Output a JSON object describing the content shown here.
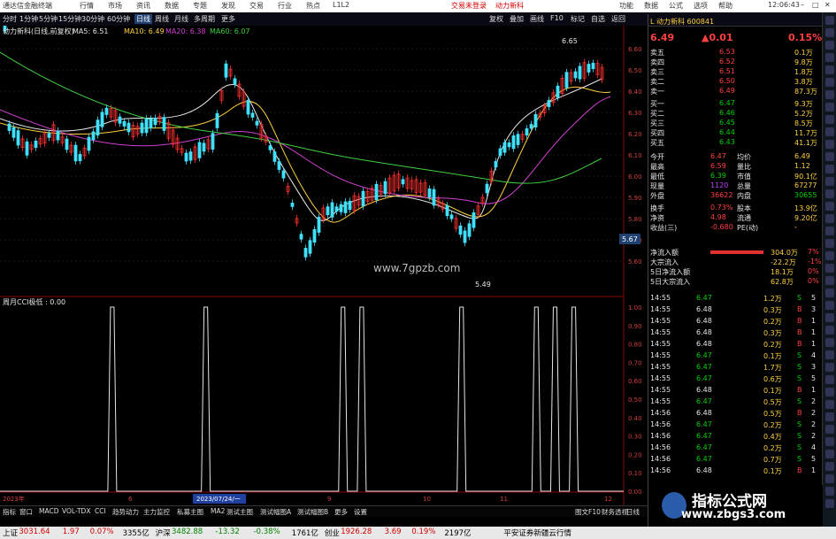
{
  "app": {
    "title": "通达信金融终端",
    "menu": [
      "行情",
      "市场",
      "资讯",
      "数据",
      "专题",
      "发现",
      "交易",
      "行业",
      "热点",
      "L1L2"
    ],
    "center_links": [
      "交易未登录",
      "动力新科"
    ],
    "right_menu": [
      "功能",
      "数据",
      "公式",
      "选项",
      "帮助"
    ]
  },
  "toolbar": {
    "periods": [
      "分时",
      "1分钟",
      "5分钟",
      "15分钟",
      "30分钟",
      "60分钟",
      "日线",
      "周线",
      "月线",
      "多周期",
      "更多"
    ],
    "active_period": "日线",
    "right_buttons": [
      "复权",
      "叠加",
      "画线",
      "F10",
      "标记",
      "自选",
      "返回"
    ]
  },
  "chart": {
    "stock_title": "动力新科(日线,前复权)",
    "ma_legend": [
      {
        "label": "MA5: 6.51",
        "color": "#e6e6e6"
      },
      {
        "label": "MA10: 6.49",
        "color": "#ffd040"
      },
      {
        "label": "MA20: 6.38",
        "color": "#d040d0"
      },
      {
        "label": "MA60: 6.07",
        "color": "#40d040"
      }
    ],
    "price_axis": [
      "6.60",
      "6.50",
      "6.40",
      "6.30",
      "6.20",
      "6.10",
      "6.00",
      "5.90",
      "5.80",
      "5.70",
      "5.60"
    ],
    "current_price_tag": "5.67",
    "high_annot": "6.65",
    "low_annot": "5.49",
    "site_text": "www.7gpzb.com",
    "indicator_title": "周月CCI极低 : 0.00",
    "indicator_axis": [
      "1.00",
      "0.90",
      "0.80",
      "0.70",
      "0.60",
      "0.50",
      "0.40",
      "0.30",
      "0.20",
      "0.10",
      "0.00"
    ],
    "date_labels": [
      "2023年",
      "6",
      "7",
      "2023/07/24/一",
      "9",
      "10",
      "11",
      "12"
    ],
    "spike_positions": [
      0.18,
      0.33,
      0.55,
      0.58,
      0.74,
      0.86,
      0.89,
      0.92
    ]
  },
  "bottom_tabs": [
    "指标",
    "窗口",
    "MACD",
    "VOL-TDX",
    "CCI",
    "趋势动力",
    "主力监控",
    "私募主图",
    "MA2",
    "测试主图",
    "测试幅图A",
    "测试幅图B",
    "更多",
    "设置"
  ],
  "bottom_tabs_right": [
    "图文F10",
    "财务透视",
    "日线"
  ],
  "quote": {
    "code_label": "L 动力新科 600841",
    "price": "6.49",
    "change": "▲0.01",
    "pct": "0.15%",
    "asks": [
      {
        "label": "卖五",
        "price": "6.53",
        "vol": "0.1万"
      },
      {
        "label": "卖四",
        "price": "6.52",
        "vol": "9.8万"
      },
      {
        "label": "卖三",
        "price": "6.51",
        "vol": "1.8万"
      },
      {
        "label": "卖二",
        "price": "6.50",
        "vol": "3.8万"
      },
      {
        "label": "卖一",
        "price": "6.49",
        "vol": "87.3万"
      }
    ],
    "bids": [
      {
        "label": "买一",
        "price": "6.47",
        "vol": "9.3万"
      },
      {
        "label": "买二",
        "price": "6.46",
        "vol": "5.2万"
      },
      {
        "label": "买三",
        "price": "6.45",
        "vol": "8.5万"
      },
      {
        "label": "买四",
        "price": "6.44",
        "vol": "11.7万"
      },
      {
        "label": "买五",
        "price": "6.43",
        "vol": "41.1万"
      }
    ],
    "stats": [
      {
        "l1": "今开",
        "v1": "6.47",
        "l2": "均价",
        "v2": "6.49"
      },
      {
        "l1": "最高",
        "v1": "6.59",
        "l2": "量比",
        "v2": "1.12"
      },
      {
        "l1": "最低",
        "v1": "6.39",
        "l2": "市值",
        "v2": "90.1亿"
      },
      {
        "l1": "现量",
        "v1": "1120",
        "l2": "总量",
        "v2": "67277"
      },
      {
        "l1": "外盘",
        "v1": "36622",
        "l2": "内盘",
        "v2": "30655"
      },
      {
        "l1": "换手",
        "v1": "0.73%",
        "l2": "股本",
        "v2": "13.9亿"
      },
      {
        "l1": "净资",
        "v1": "4.98",
        "l2": "流通",
        "v2": "9.20亿"
      },
      {
        "l1": "收益(三)",
        "v1": "-0.680",
        "l2": "PE(动)",
        "v2": "-"
      }
    ],
    "flows": [
      {
        "label": "净流入额",
        "value": "304.0万",
        "pct": "7%"
      },
      {
        "label": "大宗流入",
        "value": "-22.2万",
        "pct": "-1%"
      },
      {
        "label": "5日净流入额",
        "value": "18.1万",
        "pct": "0%"
      },
      {
        "label": "5日大宗流入",
        "value": "62.8万",
        "pct": "0%"
      }
    ],
    "ticks": [
      {
        "t": "14:55",
        "p": "6.47",
        "v": "1.2万",
        "s": "S",
        "n": "5"
      },
      {
        "t": "14:55",
        "p": "6.48",
        "v": "0.3万",
        "s": "B",
        "n": "3"
      },
      {
        "t": "14:55",
        "p": "6.48",
        "v": "0.2万",
        "s": "B",
        "n": "1"
      },
      {
        "t": "14:55",
        "p": "6.48",
        "v": "0.3万",
        "s": "B",
        "n": "1"
      },
      {
        "t": "14:55",
        "p": "6.48",
        "v": "0.2万",
        "s": "B",
        "n": "1"
      },
      {
        "t": "14:55",
        "p": "6.47",
        "v": "0.1万",
        "s": "S",
        "n": "4"
      },
      {
        "t": "14:55",
        "p": "6.47",
        "v": "1.7万",
        "s": "S",
        "n": "3"
      },
      {
        "t": "14:55",
        "p": "6.47",
        "v": "0.6万",
        "s": "S",
        "n": "5"
      },
      {
        "t": "14:55",
        "p": "6.48",
        "v": "0.1万",
        "s": "B",
        "n": "1"
      },
      {
        "t": "14:55",
        "p": "6.47",
        "v": "0.5万",
        "s": "S",
        "n": "2"
      },
      {
        "t": "14:56",
        "p": "6.48",
        "v": "0.5万",
        "s": "B",
        "n": "2"
      },
      {
        "t": "14:56",
        "p": "6.47",
        "v": "0.2万",
        "s": "S",
        "n": "2"
      },
      {
        "t": "14:56",
        "p": "6.47",
        "v": "0.4万",
        "s": "S",
        "n": "2"
      },
      {
        "t": "14:56",
        "p": "6.47",
        "v": "0.2万",
        "s": "S",
        "n": "4"
      },
      {
        "t": "14:56",
        "p": "6.47",
        "v": "0.7万",
        "s": "S",
        "n": "5"
      },
      {
        "t": "14:56",
        "p": "6.48",
        "v": "0.1万",
        "s": "B",
        "n": "1"
      }
    ]
  },
  "statusbar": [
    {
      "t": "上证",
      "c": "#000"
    },
    {
      "t": "3031.64",
      "c": "#d00000"
    },
    {
      "t": "1.97",
      "c": "#d00000"
    },
    {
      "t": "0.07%",
      "c": "#d00000"
    },
    {
      "t": "3355亿",
      "c": "#000"
    },
    {
      "t": "沪深",
      "c": "#000"
    },
    {
      "t": "3482.88",
      "c": "#008000"
    },
    {
      "t": "-13.32",
      "c": "#008000"
    },
    {
      "t": "-0.38%",
      "c": "#008000"
    },
    {
      "t": "1761亿",
      "c": "#000"
    },
    {
      "t": "创业",
      "c": "#000"
    },
    {
      "t": "1926.28",
      "c": "#d00000"
    },
    {
      "t": "3.69",
      "c": "#d00000"
    },
    {
      "t": "0.19%",
      "c": "#d00000"
    },
    {
      "t": "2197亿",
      "c": "#000"
    },
    {
      "t": "平安证券新疆云行情",
      "c": "#000"
    }
  ],
  "clock": "12:06:43",
  "watermark": {
    "line1": "指标公式网",
    "line2": "www.zbgs3.com"
  }
}
